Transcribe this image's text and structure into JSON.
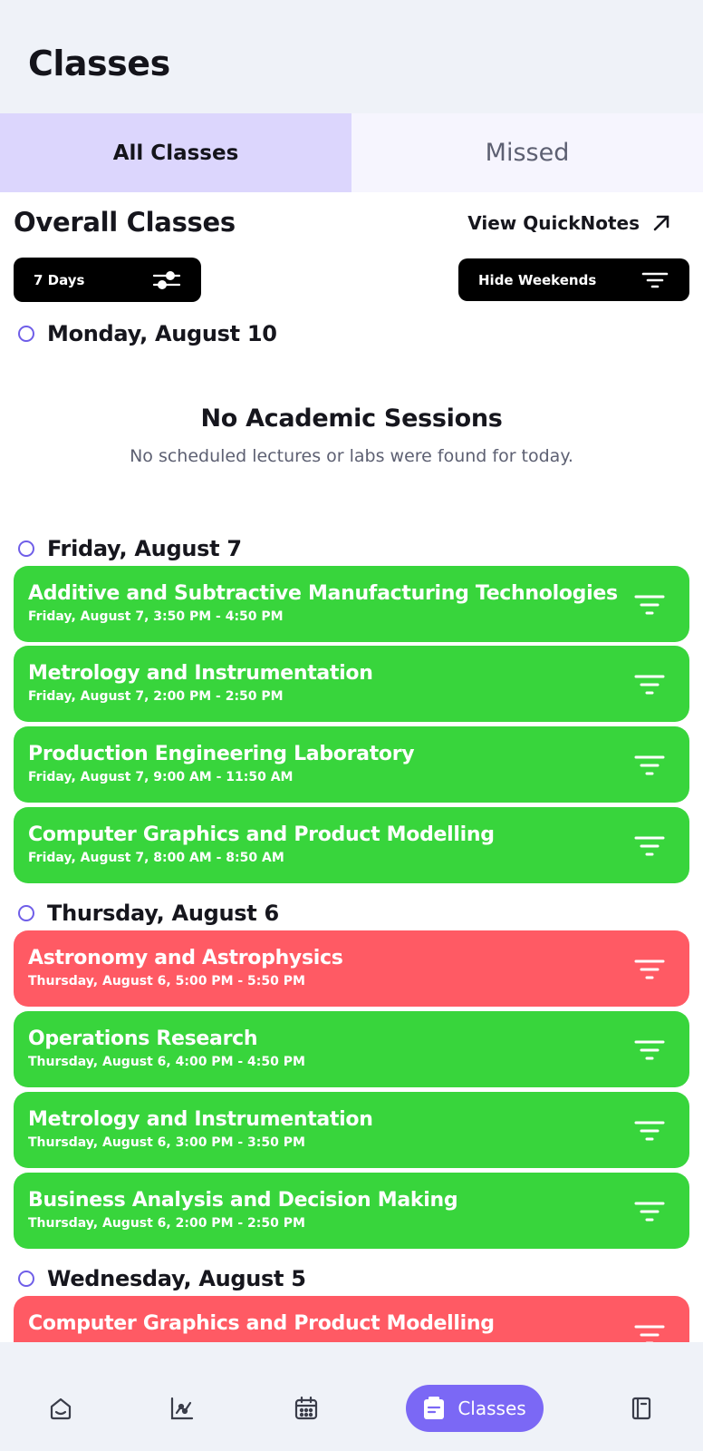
{
  "page": {
    "title": "Classes"
  },
  "tabs": [
    {
      "label": "All Classes",
      "active": true
    },
    {
      "label": "Missed",
      "active": false
    }
  ],
  "section": {
    "title": "Overall Classes",
    "quicknotes_label": "View QuickNotes"
  },
  "filters": {
    "days_label": "7 Days",
    "weekends_label": "Hide Weekends"
  },
  "days": [
    {
      "label": "Monday, August 10"
    },
    {
      "label": "Friday, August 7"
    },
    {
      "label": "Thursday, August 6"
    },
    {
      "label": "Wednesday, August 5"
    }
  ],
  "empty": {
    "title": "No Academic Sessions",
    "subtitle": "No scheduled lectures or labs were found for today."
  },
  "classes": [
    {
      "title": "Additive and Subtractive Manufacturing Technologies",
      "time": "Friday, August 7, 3:50 PM - 4:50 PM",
      "status": "attended",
      "color": "#38d53c"
    },
    {
      "title": "Metrology and Instrumentation",
      "time": "Friday, August 7, 2:00 PM - 2:50 PM",
      "status": "attended",
      "color": "#38d53c"
    },
    {
      "title": "Production Engineering Laboratory",
      "time": "Friday, August 7, 9:00 AM - 11:50 AM",
      "status": "attended",
      "color": "#38d53c"
    },
    {
      "title": "Computer Graphics and Product Modelling",
      "time": "Friday, August 7, 8:00 AM - 8:50 AM",
      "status": "attended",
      "color": "#38d53c"
    },
    {
      "title": "Astronomy and Astrophysics",
      "time": "Thursday, August 6, 5:00 PM - 5:50 PM",
      "status": "missed",
      "color": "#ff5a64"
    },
    {
      "title": "Operations Research",
      "time": "Thursday, August 6, 4:00 PM - 4:50 PM",
      "status": "attended",
      "color": "#38d53c"
    },
    {
      "title": "Metrology and Instrumentation",
      "time": "Thursday, August 6, 3:00 PM - 3:50 PM",
      "status": "attended",
      "color": "#38d53c"
    },
    {
      "title": "Business Analysis and Decision Making",
      "time": "Thursday, August 6, 2:00 PM - 2:50 PM",
      "status": "attended",
      "color": "#38d53c"
    },
    {
      "title": "Computer Graphics and Product Modelling",
      "time": "",
      "status": "missed",
      "color": "#ff5a64"
    }
  ],
  "nav": {
    "items": [
      {
        "icon": "home-icon"
      },
      {
        "icon": "analytics-icon"
      },
      {
        "icon": "calendar-icon"
      },
      {
        "icon": "classes-icon",
        "label": "Classes",
        "active": true
      },
      {
        "icon": "notebook-icon"
      }
    ],
    "accent": "#7b68f5"
  }
}
